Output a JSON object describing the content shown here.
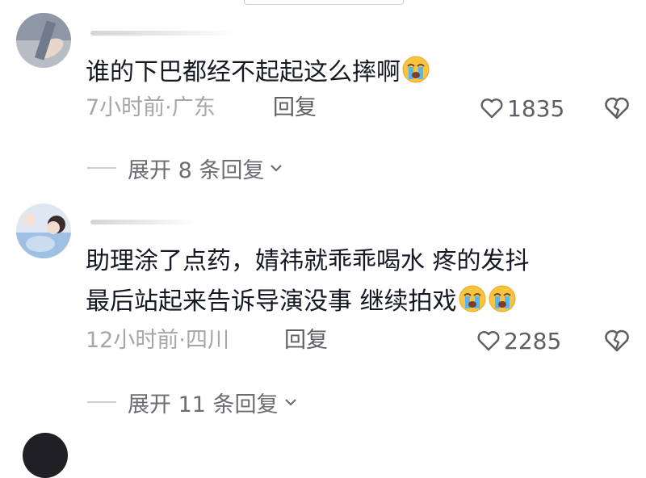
{
  "comments": [
    {
      "text": "谁的下巴都经不起起这么摔啊",
      "emoji": "loudly-crying-face",
      "time_location": "7小时前·广东",
      "reply_label": "回复",
      "likes": "1835",
      "expand_label": "展开 8 条回复"
    },
    {
      "text_line1": "助理涂了点药，婧祎就乖乖喝水 疼的发抖",
      "text_line2": "最后站起来告诉导演没事 继续拍戏",
      "emoji": "loudly-crying-face",
      "time_location": "12小时前·四川",
      "reply_label": "回复",
      "likes": "2285",
      "expand_label": "展开 11 条回复"
    }
  ],
  "icons": {
    "like": "heart-outline-icon",
    "dislike": "broken-heart-icon",
    "expand": "chevron-down-icon"
  },
  "colors": {
    "text": "#161823",
    "meta": "#a6a6aa",
    "action": "#5e5e66"
  }
}
